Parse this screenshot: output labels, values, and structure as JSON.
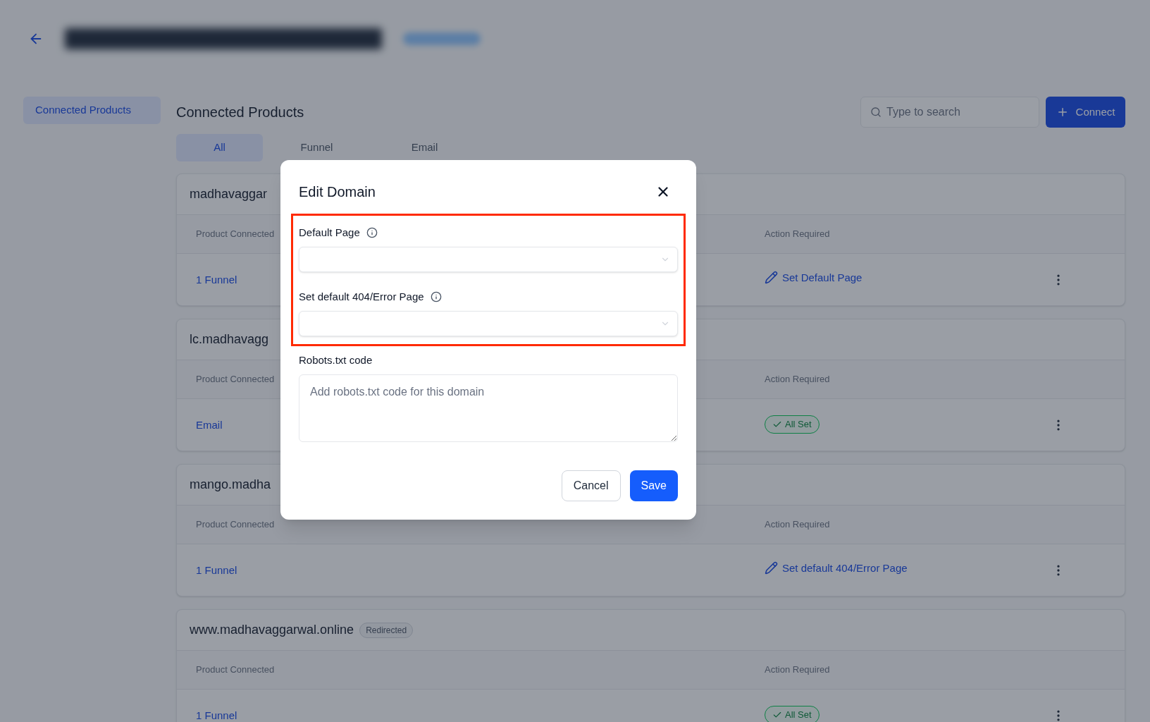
{
  "sidebar": {
    "items": [
      {
        "label": "Connected Products",
        "selected": true
      }
    ]
  },
  "main": {
    "title": "Connected Products",
    "search": {
      "placeholder": "Type to search"
    },
    "connect_button": {
      "label": "Connect"
    },
    "tabs": [
      {
        "label": "All",
        "selected": true
      },
      {
        "label": "Funnel",
        "selected": false
      },
      {
        "label": "Email",
        "selected": false
      }
    ],
    "domains": [
      {
        "name": "madhavaggar",
        "columns": [
          "Product Connected",
          "Action Required"
        ],
        "product": "1 Funnel",
        "action": {
          "kind": "link",
          "label": "Set Default Page"
        }
      },
      {
        "name": "lc.madhavagg",
        "columns": [
          "Product Connected",
          "Action Required"
        ],
        "product": "Email",
        "action": {
          "kind": "status",
          "label": "All Set"
        }
      },
      {
        "name": "mango.madha",
        "columns": [
          "Product Connected",
          "Action Required"
        ],
        "product": "1 Funnel",
        "action": {
          "kind": "link",
          "label": "Set default 404/Error Page"
        }
      },
      {
        "name": "www.madhavaggarwal.online",
        "badge": "Redirected",
        "columns": [
          "Product Connected",
          "Action Required"
        ],
        "product": "1 Funnel",
        "action": {
          "kind": "status",
          "label": "All Set"
        }
      }
    ]
  },
  "modal": {
    "title": "Edit Domain",
    "fields": [
      {
        "kind": "select",
        "label": "Default Page",
        "info": true,
        "highlighted": true
      },
      {
        "kind": "select",
        "label": "Set default 404/Error Page",
        "info": true,
        "highlighted": true
      },
      {
        "kind": "textarea",
        "label": "Robots.txt code",
        "placeholder": "Add robots.txt code for this domain",
        "info": false,
        "highlighted": false
      }
    ],
    "buttons": [
      {
        "label": "Cancel",
        "kind": "secondary"
      },
      {
        "label": "Save",
        "kind": "primary"
      }
    ]
  }
}
